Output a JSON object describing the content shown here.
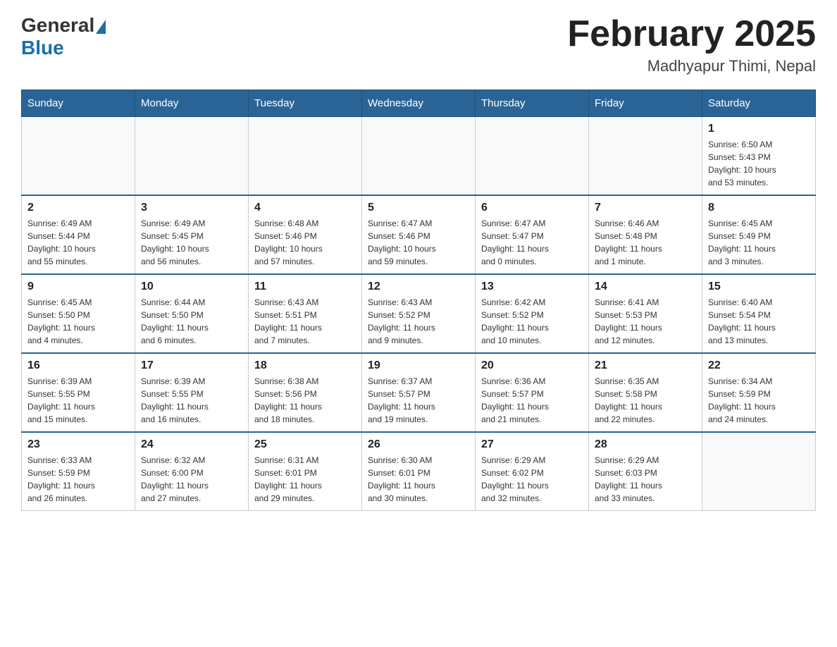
{
  "header": {
    "logo": {
      "general": "General",
      "blue": "Blue"
    },
    "title": "February 2025",
    "location": "Madhyapur Thimi, Nepal"
  },
  "days_of_week": [
    "Sunday",
    "Monday",
    "Tuesday",
    "Wednesday",
    "Thursday",
    "Friday",
    "Saturday"
  ],
  "weeks": [
    [
      {
        "day": "",
        "info": ""
      },
      {
        "day": "",
        "info": ""
      },
      {
        "day": "",
        "info": ""
      },
      {
        "day": "",
        "info": ""
      },
      {
        "day": "",
        "info": ""
      },
      {
        "day": "",
        "info": ""
      },
      {
        "day": "1",
        "info": "Sunrise: 6:50 AM\nSunset: 5:43 PM\nDaylight: 10 hours\nand 53 minutes."
      }
    ],
    [
      {
        "day": "2",
        "info": "Sunrise: 6:49 AM\nSunset: 5:44 PM\nDaylight: 10 hours\nand 55 minutes."
      },
      {
        "day": "3",
        "info": "Sunrise: 6:49 AM\nSunset: 5:45 PM\nDaylight: 10 hours\nand 56 minutes."
      },
      {
        "day": "4",
        "info": "Sunrise: 6:48 AM\nSunset: 5:46 PM\nDaylight: 10 hours\nand 57 minutes."
      },
      {
        "day": "5",
        "info": "Sunrise: 6:47 AM\nSunset: 5:46 PM\nDaylight: 10 hours\nand 59 minutes."
      },
      {
        "day": "6",
        "info": "Sunrise: 6:47 AM\nSunset: 5:47 PM\nDaylight: 11 hours\nand 0 minutes."
      },
      {
        "day": "7",
        "info": "Sunrise: 6:46 AM\nSunset: 5:48 PM\nDaylight: 11 hours\nand 1 minute."
      },
      {
        "day": "8",
        "info": "Sunrise: 6:45 AM\nSunset: 5:49 PM\nDaylight: 11 hours\nand 3 minutes."
      }
    ],
    [
      {
        "day": "9",
        "info": "Sunrise: 6:45 AM\nSunset: 5:50 PM\nDaylight: 11 hours\nand 4 minutes."
      },
      {
        "day": "10",
        "info": "Sunrise: 6:44 AM\nSunset: 5:50 PM\nDaylight: 11 hours\nand 6 minutes."
      },
      {
        "day": "11",
        "info": "Sunrise: 6:43 AM\nSunset: 5:51 PM\nDaylight: 11 hours\nand 7 minutes."
      },
      {
        "day": "12",
        "info": "Sunrise: 6:43 AM\nSunset: 5:52 PM\nDaylight: 11 hours\nand 9 minutes."
      },
      {
        "day": "13",
        "info": "Sunrise: 6:42 AM\nSunset: 5:52 PM\nDaylight: 11 hours\nand 10 minutes."
      },
      {
        "day": "14",
        "info": "Sunrise: 6:41 AM\nSunset: 5:53 PM\nDaylight: 11 hours\nand 12 minutes."
      },
      {
        "day": "15",
        "info": "Sunrise: 6:40 AM\nSunset: 5:54 PM\nDaylight: 11 hours\nand 13 minutes."
      }
    ],
    [
      {
        "day": "16",
        "info": "Sunrise: 6:39 AM\nSunset: 5:55 PM\nDaylight: 11 hours\nand 15 minutes."
      },
      {
        "day": "17",
        "info": "Sunrise: 6:39 AM\nSunset: 5:55 PM\nDaylight: 11 hours\nand 16 minutes."
      },
      {
        "day": "18",
        "info": "Sunrise: 6:38 AM\nSunset: 5:56 PM\nDaylight: 11 hours\nand 18 minutes."
      },
      {
        "day": "19",
        "info": "Sunrise: 6:37 AM\nSunset: 5:57 PM\nDaylight: 11 hours\nand 19 minutes."
      },
      {
        "day": "20",
        "info": "Sunrise: 6:36 AM\nSunset: 5:57 PM\nDaylight: 11 hours\nand 21 minutes."
      },
      {
        "day": "21",
        "info": "Sunrise: 6:35 AM\nSunset: 5:58 PM\nDaylight: 11 hours\nand 22 minutes."
      },
      {
        "day": "22",
        "info": "Sunrise: 6:34 AM\nSunset: 5:59 PM\nDaylight: 11 hours\nand 24 minutes."
      }
    ],
    [
      {
        "day": "23",
        "info": "Sunrise: 6:33 AM\nSunset: 5:59 PM\nDaylight: 11 hours\nand 26 minutes."
      },
      {
        "day": "24",
        "info": "Sunrise: 6:32 AM\nSunset: 6:00 PM\nDaylight: 11 hours\nand 27 minutes."
      },
      {
        "day": "25",
        "info": "Sunrise: 6:31 AM\nSunset: 6:01 PM\nDaylight: 11 hours\nand 29 minutes."
      },
      {
        "day": "26",
        "info": "Sunrise: 6:30 AM\nSunset: 6:01 PM\nDaylight: 11 hours\nand 30 minutes."
      },
      {
        "day": "27",
        "info": "Sunrise: 6:29 AM\nSunset: 6:02 PM\nDaylight: 11 hours\nand 32 minutes."
      },
      {
        "day": "28",
        "info": "Sunrise: 6:29 AM\nSunset: 6:03 PM\nDaylight: 11 hours\nand 33 minutes."
      },
      {
        "day": "",
        "info": ""
      }
    ]
  ]
}
